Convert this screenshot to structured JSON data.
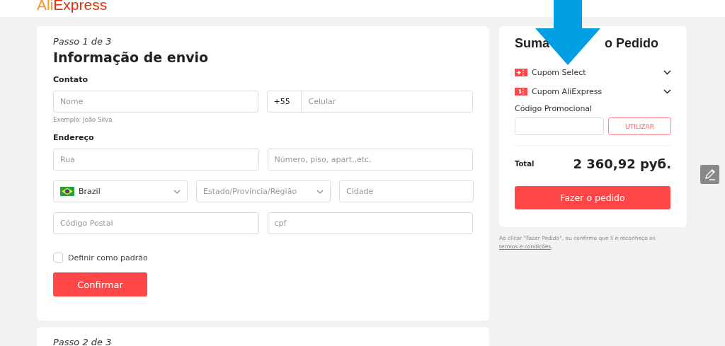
{
  "header": {
    "logo_part_1": "Ali",
    "logo_part_2": "Express"
  },
  "step1": {
    "step": "Passo 1 de 3",
    "title": "Informação de envio",
    "contact_label": "Contato",
    "name_placeholder": "Nome",
    "name_hint": "Exemplo: João Silva",
    "phone_prefix": "+55",
    "phone_placeholder": "Celular",
    "address_label": "Endereço",
    "street_placeholder": "Rua",
    "number_placeholder": "Número, piso, apart.,etc.",
    "country": "Brazil",
    "state_placeholder": "Estado/Província/Região",
    "city_placeholder": "Cidade",
    "postal_placeholder": "Código Postal",
    "cpf_placeholder": "cpf",
    "default_checkbox": {
      "label": "Definir como padrão",
      "checked": false
    },
    "confirm_button": "Confirmar"
  },
  "step2": {
    "step": "Passo 2 de 3"
  },
  "summary": {
    "title_parts": [
      "Suma",
      "o Pedido"
    ],
    "coupons": [
      {
        "label": "Cupom Select",
        "kind": "plus"
      },
      {
        "label": "Cupom AliExpress",
        "kind": "dollar"
      }
    ],
    "promo_label": "Código Promocional",
    "promo_button": "UTILIZAR",
    "total_label": "Total",
    "total_value": "2 360,92 руб.",
    "order_button": "Fazer o pedido"
  },
  "disclaimer": {
    "text": "Ao clicar \"Fazer Pedido\", eu confirmo que li e reconheço os ",
    "link": "termos e condições",
    "end": "."
  }
}
